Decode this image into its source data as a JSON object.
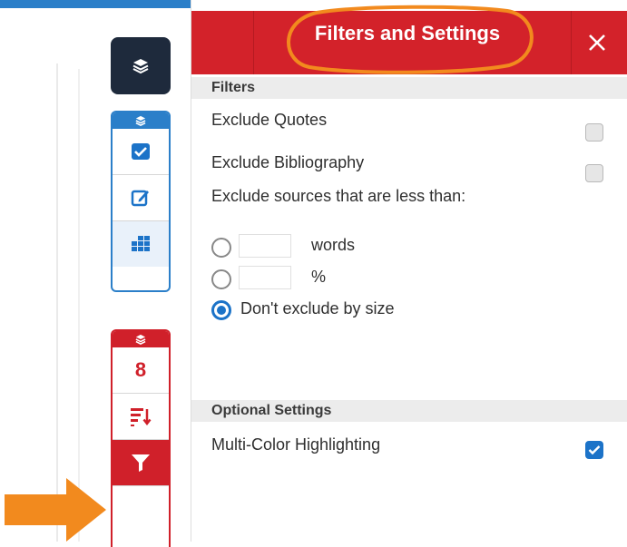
{
  "panel": {
    "title": "Filters and Settings",
    "close_label": "×",
    "header_color": "#d3222a",
    "annotation_color": "#f28a1e"
  },
  "filters": {
    "heading": "Filters",
    "exclude_quotes": {
      "label": "Exclude Quotes",
      "checked": false
    },
    "exclude_bibliography": {
      "label": "Exclude Bibliography",
      "checked": false
    },
    "exclude_size_label": "Exclude sources that are less than:",
    "size_options": [
      {
        "suffix": "words",
        "value": "",
        "selected": false
      },
      {
        "suffix": "%",
        "value": "",
        "selected": false
      },
      {
        "label": "Don't exclude by size",
        "selected": true
      }
    ]
  },
  "optional": {
    "heading": "Optional Settings",
    "multi_color": {
      "label": "Multi-Color Highlighting",
      "checked": true
    }
  },
  "toolbar": {
    "match_count": "8",
    "icons": [
      "layers-icon",
      "checkbox-icon",
      "edit-icon",
      "grid-icon",
      "sort-icon",
      "filter-icon"
    ]
  },
  "colors": {
    "blue": "#2b7fc9",
    "red": "#d0202a",
    "dark": "#1e2a3c"
  }
}
